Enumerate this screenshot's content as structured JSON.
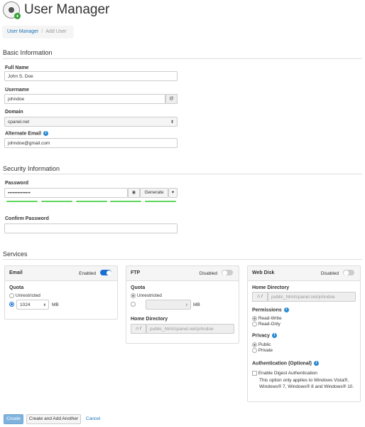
{
  "header": {
    "title": "User Manager"
  },
  "breadcrumb": {
    "link": "User Manager",
    "current": "Add User"
  },
  "basic": {
    "heading": "Basic Information",
    "full_name_label": "Full Name",
    "full_name_value": "John S. Doe",
    "username_label": "Username",
    "username_value": "johndoe",
    "at_symbol": "@",
    "domain_label": "Domain",
    "domain_value": "cpanel.net",
    "alt_email_label": "Alternate Email",
    "alt_email_value": "johndoe@gmail.com"
  },
  "security": {
    "heading": "Security Information",
    "password_label": "Password",
    "password_value": "••••••••••••••",
    "generate_label": "Generate",
    "strength_segments": 5,
    "strength_color": "#5cd65c",
    "confirm_label": "Confirm Password"
  },
  "services": {
    "heading": "Services",
    "email": {
      "title": "Email",
      "status": "Enabled",
      "enabled": true,
      "quota_label": "Quota",
      "unrestricted_label": "Unrestricted",
      "quota_value": "1024",
      "unit": "MB"
    },
    "ftp": {
      "title": "FTP",
      "status": "Disabled",
      "enabled": false,
      "quota_label": "Quota",
      "unrestricted_label": "Unrestricted",
      "unit": "MB",
      "home_label": "Home Directory",
      "home_value": "public_html/cpanel.net/johndoe"
    },
    "webdisk": {
      "title": "Web Disk",
      "status": "Disabled",
      "enabled": false,
      "home_label": "Home Directory",
      "home_value": "public_html/cpanel.net/johndoe",
      "permissions_label": "Permissions",
      "perm_rw": "Read-Write",
      "perm_ro": "Read-Only",
      "privacy_label": "Privacy",
      "privacy_public": "Public",
      "privacy_private": "Private",
      "auth_label": "Authentication (Optional)",
      "digest_label": "Enable Digest Authentication",
      "digest_note": "This option only applies to Windows Vista®, Windows® 7, Windows® 8 and Windows® 10."
    }
  },
  "actions": {
    "create": "Create",
    "create_another": "Create and Add Another",
    "cancel": "Cancel"
  },
  "colors": {
    "accent": "#1a6fd1",
    "link": "#1a73b8"
  }
}
